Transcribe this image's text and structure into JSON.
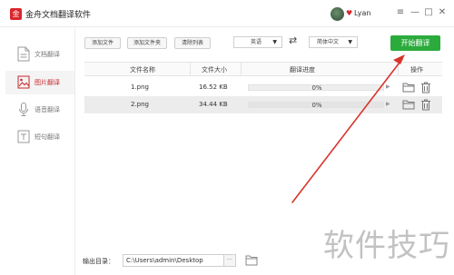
{
  "app": {
    "title": "金舟文档翻译软件",
    "logo_char": "金"
  },
  "user": {
    "name": "Lyan"
  },
  "window_controls": {
    "menu": "≡",
    "minimize": "—",
    "maximize": "□",
    "close": "✕"
  },
  "sidebar": {
    "items": [
      {
        "label": "文档翻译",
        "icon": "document-icon",
        "active": false
      },
      {
        "label": "图片翻译",
        "icon": "image-icon",
        "active": true
      },
      {
        "label": "语音翻译",
        "icon": "microphone-icon",
        "active": false
      },
      {
        "label": "短句翻译",
        "icon": "text-icon",
        "active": false
      }
    ]
  },
  "toolbar": {
    "add_file": "添加文件",
    "add_folder": "添加文件夹",
    "clear_list": "清除列表",
    "source_lang": "英语",
    "target_lang": "简体中文",
    "swap": "⇄",
    "start": "开始翻译"
  },
  "table": {
    "headers": {
      "name": "文件名称",
      "size": "文件大小",
      "progress": "翻译进度",
      "action": "操作"
    },
    "rows": [
      {
        "name": "1.png",
        "size": "16.52 KB",
        "progress_text": "0%",
        "progress": 0
      },
      {
        "name": "2.png",
        "size": "34.44 KB",
        "progress_text": "0%",
        "progress": 0
      }
    ]
  },
  "output": {
    "label": "输出目录：",
    "path": "C:\\Users\\admin\\Desktop",
    "more": "···"
  },
  "watermark": "软件技巧",
  "colors": {
    "brand": "#d9262b",
    "start_button": "#2bab3c",
    "arrow": "#d9342b"
  }
}
